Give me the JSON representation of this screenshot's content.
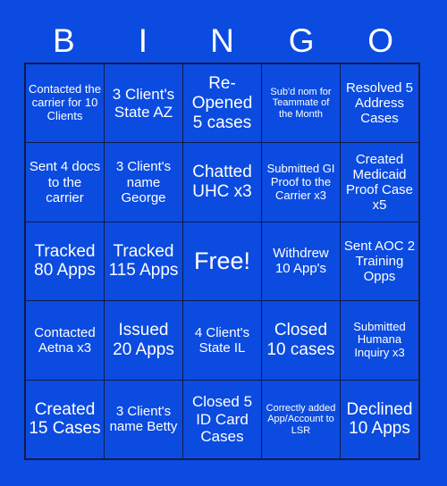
{
  "header": {
    "letters": [
      "B",
      "I",
      "N",
      "G",
      "O"
    ]
  },
  "colors": {
    "background": "#0b4be0",
    "cell_background": "#0b4be0",
    "border": "#121a4a",
    "text": "#ffffff"
  },
  "grid": {
    "rows": 5,
    "columns": 5,
    "cells": [
      [
        {
          "text": "Contacted the carrier for 10 Clients",
          "size": "fs-s",
          "free": false
        },
        {
          "text": "3 Client's State AZ",
          "size": "fs-l",
          "free": false
        },
        {
          "text": "Re-Opened 5 cases",
          "size": "fs-xl",
          "free": false
        },
        {
          "text": "Sub'd nom for Teammate of the Month",
          "size": "fs-xs",
          "free": false
        },
        {
          "text": "Resolved 5 Address Cases",
          "size": "fs-m",
          "free": false
        }
      ],
      [
        {
          "text": "Sent 4 docs to the carrier",
          "size": "fs-m",
          "free": false
        },
        {
          "text": "3 Client's name George",
          "size": "fs-m",
          "free": false
        },
        {
          "text": "Chatted UHC x3",
          "size": "fs-xl",
          "free": false
        },
        {
          "text": "Submitted GI Proof to the Carrier x3",
          "size": "fs-s",
          "free": false
        },
        {
          "text": "Created Medicaid Proof Case x5",
          "size": "fs-m",
          "free": false
        }
      ],
      [
        {
          "text": "Tracked 80 Apps",
          "size": "fs-xl",
          "free": false
        },
        {
          "text": "Tracked 115 Apps",
          "size": "fs-xl",
          "free": false
        },
        {
          "text": "Free!",
          "size": "fs-free",
          "free": true
        },
        {
          "text": "Withdrew 10 App's",
          "size": "fs-m",
          "free": false
        },
        {
          "text": "Sent AOC 2 Training Opps",
          "size": "fs-m",
          "free": false
        }
      ],
      [
        {
          "text": "Contacted Aetna x3",
          "size": "fs-m",
          "free": false
        },
        {
          "text": "Issued 20 Apps",
          "size": "fs-xl",
          "free": false
        },
        {
          "text": "4 Client's State IL",
          "size": "fs-m",
          "free": false
        },
        {
          "text": "Closed 10 cases",
          "size": "fs-xl",
          "free": false
        },
        {
          "text": "Submitted Humana Inquiry x3",
          "size": "fs-s",
          "free": false
        }
      ],
      [
        {
          "text": "Created 15 Cases",
          "size": "fs-xl",
          "free": false
        },
        {
          "text": "3 Client's name Betty",
          "size": "fs-m",
          "free": false
        },
        {
          "text": "Closed 5 ID Card Cases",
          "size": "fs-l",
          "free": false
        },
        {
          "text": "Correctly added App/Account to LSR",
          "size": "fs-xs",
          "free": false
        },
        {
          "text": "Declined 10 Apps",
          "size": "fs-xl",
          "free": false
        }
      ]
    ]
  }
}
